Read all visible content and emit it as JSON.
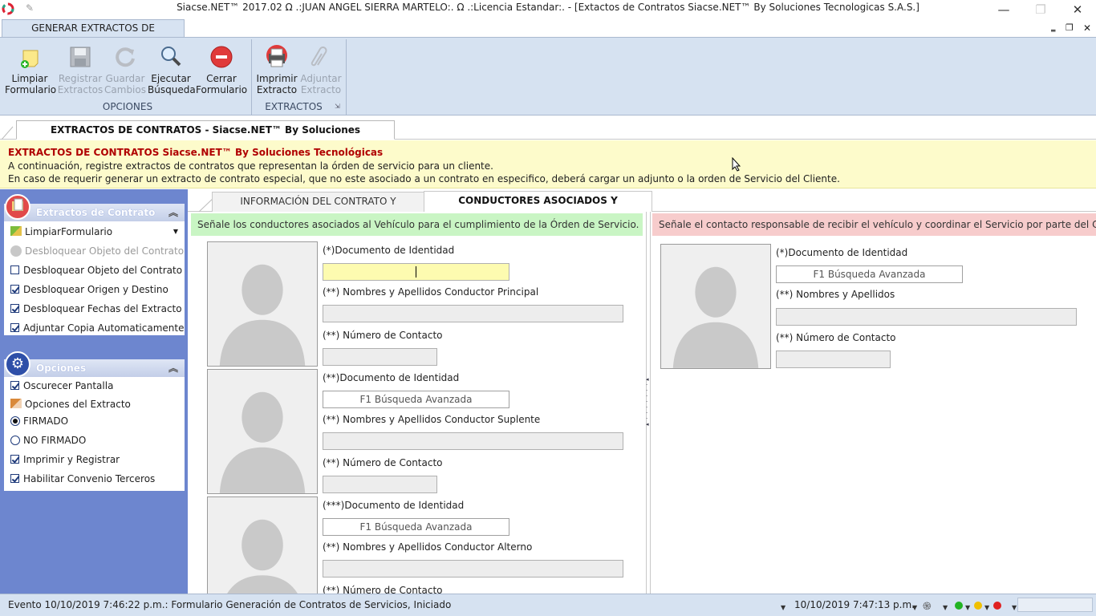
{
  "window": {
    "title": "Siacse.NET™ 2017.02 Ω  .:JUAN ANGEL SIERRA MARTELO:. Ω  .:Licencia Estandar:. - [Extactos de Contratos Siacse.NET™ By Soluciones Tecnologicas S.A.S.]",
    "minimize": "—",
    "maximize": "❐",
    "close": "✕"
  },
  "ribbon": {
    "tab": "GENERAR EXTRACTOS DE CONTRATOS",
    "groups": {
      "opciones": "OPCIONES",
      "extractos": "EXTRACTOS"
    },
    "buttons": {
      "limpiar": [
        "Limpiar",
        "Formulario"
      ],
      "registrar": [
        "Registrar",
        "Extractos"
      ],
      "guardar": [
        "Guardar",
        "Cambios"
      ],
      "ejecutar": [
        "Ejecutar",
        "Búsqueda"
      ],
      "cerrar": [
        "Cerrar",
        "Formulario"
      ],
      "imprimir": [
        "Imprimir",
        "Extracto"
      ],
      "adjuntar": [
        "Adjuntar",
        "Extracto"
      ]
    },
    "mdi": {
      "min": "‗",
      "restore": "❐",
      "close": "✕"
    }
  },
  "doc_tab": "EXTRACTOS DE CONTRATOS - Siacse.NET™ By Soluciones Tecnológicas S.A.S.",
  "info": {
    "title": "EXTRACTOS DE CONTRATOS Siacse.NET™ By Soluciones Tecnológicas",
    "line1": "A continuación, registre extractos de contratos que representan la órden de servicio para un cliente.",
    "line2": "En caso de requerir generar un extracto de contrato especial, que no este asociado a un contrato en especifico, deberá cargar un adjunto o la orden de Servicio del Cliente."
  },
  "left_panel": {
    "extractos": {
      "title": "Extractos de Contrato",
      "items": [
        {
          "label": "LimpiarFormulario"
        },
        {
          "label": "Desbloquear Objeto del Contrato"
        },
        {
          "label": "Desbloquear Objeto del Contrato",
          "checked": false
        },
        {
          "label": "Desbloquear Origen y Destino",
          "checked": true
        },
        {
          "label": "Desbloquear Fechas del Extracto",
          "checked": true
        },
        {
          "label": "Adjuntar Copia Automaticamente",
          "checked": true
        }
      ]
    },
    "opciones": {
      "title": "Opciones",
      "items": [
        {
          "label": "Oscurecer Pantalla",
          "checked": true
        },
        {
          "label": "Opciones del Extracto"
        },
        {
          "label": "FIRMADO",
          "selected": true
        },
        {
          "label": "NO FIRMADO",
          "selected": false
        },
        {
          "label": "Imprimir y Registrar",
          "checked": true
        },
        {
          "label": "Habilitar Convenio Terceros",
          "checked": true
        }
      ]
    }
  },
  "tabs": {
    "tab1": "INFORMACIÓN DEL CONTRATO Y RECORRIDO",
    "tab2": "CONDUCTORES ASOCIADOS Y RESPONSABLE"
  },
  "drivers": {
    "header": "Señale los conductores asociados al Vehículo para el cumplimiento de la Órden de Servicio.",
    "principal": {
      "doc_label": "(*)Documento de Identidad",
      "doc_value": "",
      "name_label": "(**) Nombres y Apellidos Conductor Principal",
      "name_value": "",
      "contact_label": "(**) Número de Contacto",
      "contact_value": ""
    },
    "suplente": {
      "doc_label": "(**)Documento de Identidad",
      "doc_value": "F1 Búsqueda Avanzada",
      "name_label": "(**) Nombres y Apellidos Conductor Suplente",
      "name_value": "",
      "contact_label": "(**) Número de Contacto",
      "contact_value": ""
    },
    "alterno": {
      "doc_label": "(***)Documento de Identidad",
      "doc_value": "F1 Búsqueda Avanzada",
      "name_label": "(**) Nombres y Apellidos Conductor Alterno",
      "name_value": "",
      "contact_label": "(**) Número de Contacto"
    }
  },
  "responsable": {
    "header": "Señale el contacto responsable de recibir el vehículo y coordinar el Servicio por parte del Cliente.",
    "doc_label": "(*)Documento de Identidad",
    "doc_value": "F1 Búsqueda Avanzada",
    "name_label": "(**) Nombres y Apellidos",
    "name_value": "",
    "contact_label": "(**) Número de Contacto",
    "contact_value": ""
  },
  "status": {
    "event": "Evento 10/10/2019 7:46:22 p.m.: Formulario Generación de Contratos de Servicios, Iniciado",
    "datetime": "10/10/2019 7:47:13 p.m.",
    "colors": {
      "green": "#22b322",
      "yellow": "#f0c000",
      "red": "#e02020"
    }
  },
  "colors": {
    "ribbon_bg": "#d6e2f1",
    "left_bg": "#6d86cf",
    "info_bg": "#fdfbcb",
    "info_title": "#b00000",
    "green_bar": "#c9f5c4",
    "red_bar": "#f7cccc"
  }
}
